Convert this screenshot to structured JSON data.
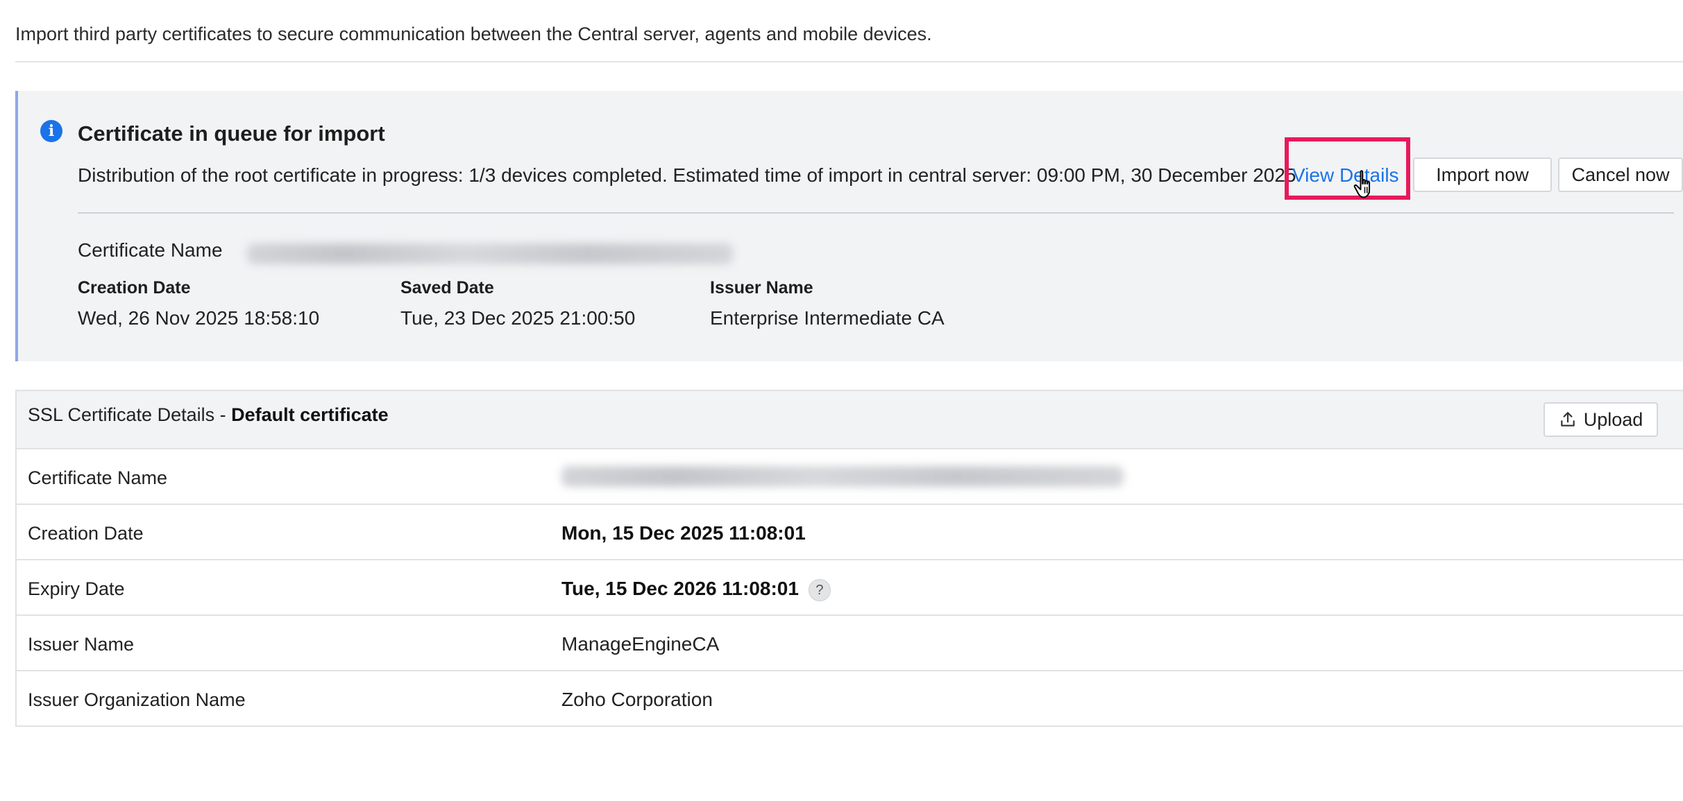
{
  "intro": {
    "text": "Import third party certificates to secure communication between the Central server, agents and mobile devices."
  },
  "queue": {
    "title": "Certificate in queue for import",
    "description": "Distribution of the root certificate in progress: 1/3 devices completed. Estimated time of import in central server: 09:00 PM, 30 December 2025",
    "view_details_label": "View Details",
    "import_now_label": "Import now",
    "cancel_now_label": "Cancel now",
    "certificate_name_label": "Certificate Name",
    "creation_date_label": "Creation Date",
    "creation_date_value": "Wed, 26 Nov 2025 18:58:10",
    "saved_date_label": "Saved Date",
    "saved_date_value": "Tue, 23 Dec 2025 21:00:50",
    "issuer_name_label": "Issuer Name",
    "issuer_name_value": "Enterprise Intermediate CA"
  },
  "ssl": {
    "header_prefix": "SSL Certificate Details - ",
    "header_name": "Default certificate",
    "upload_label": "Upload",
    "rows": [
      {
        "label": "Certificate Name",
        "value": ""
      },
      {
        "label": "Creation Date",
        "value": "Mon, 15 Dec 2025 11:08:01"
      },
      {
        "label": "Expiry Date",
        "value": "Tue, 15 Dec 2026 11:08:01"
      },
      {
        "label": "Issuer Name",
        "value": "ManageEngineCA"
      },
      {
        "label": "Issuer Organization Name",
        "value": "Zoho Corporation"
      }
    ]
  },
  "icons": {
    "info": "info-icon",
    "upload": "upload-icon",
    "help": "help-icon",
    "cursor": "hand-pointer-cursor"
  },
  "colors": {
    "accent": "#1a73e8",
    "highlight": "#e8195a",
    "panel_bg": "#f2f3f5"
  }
}
